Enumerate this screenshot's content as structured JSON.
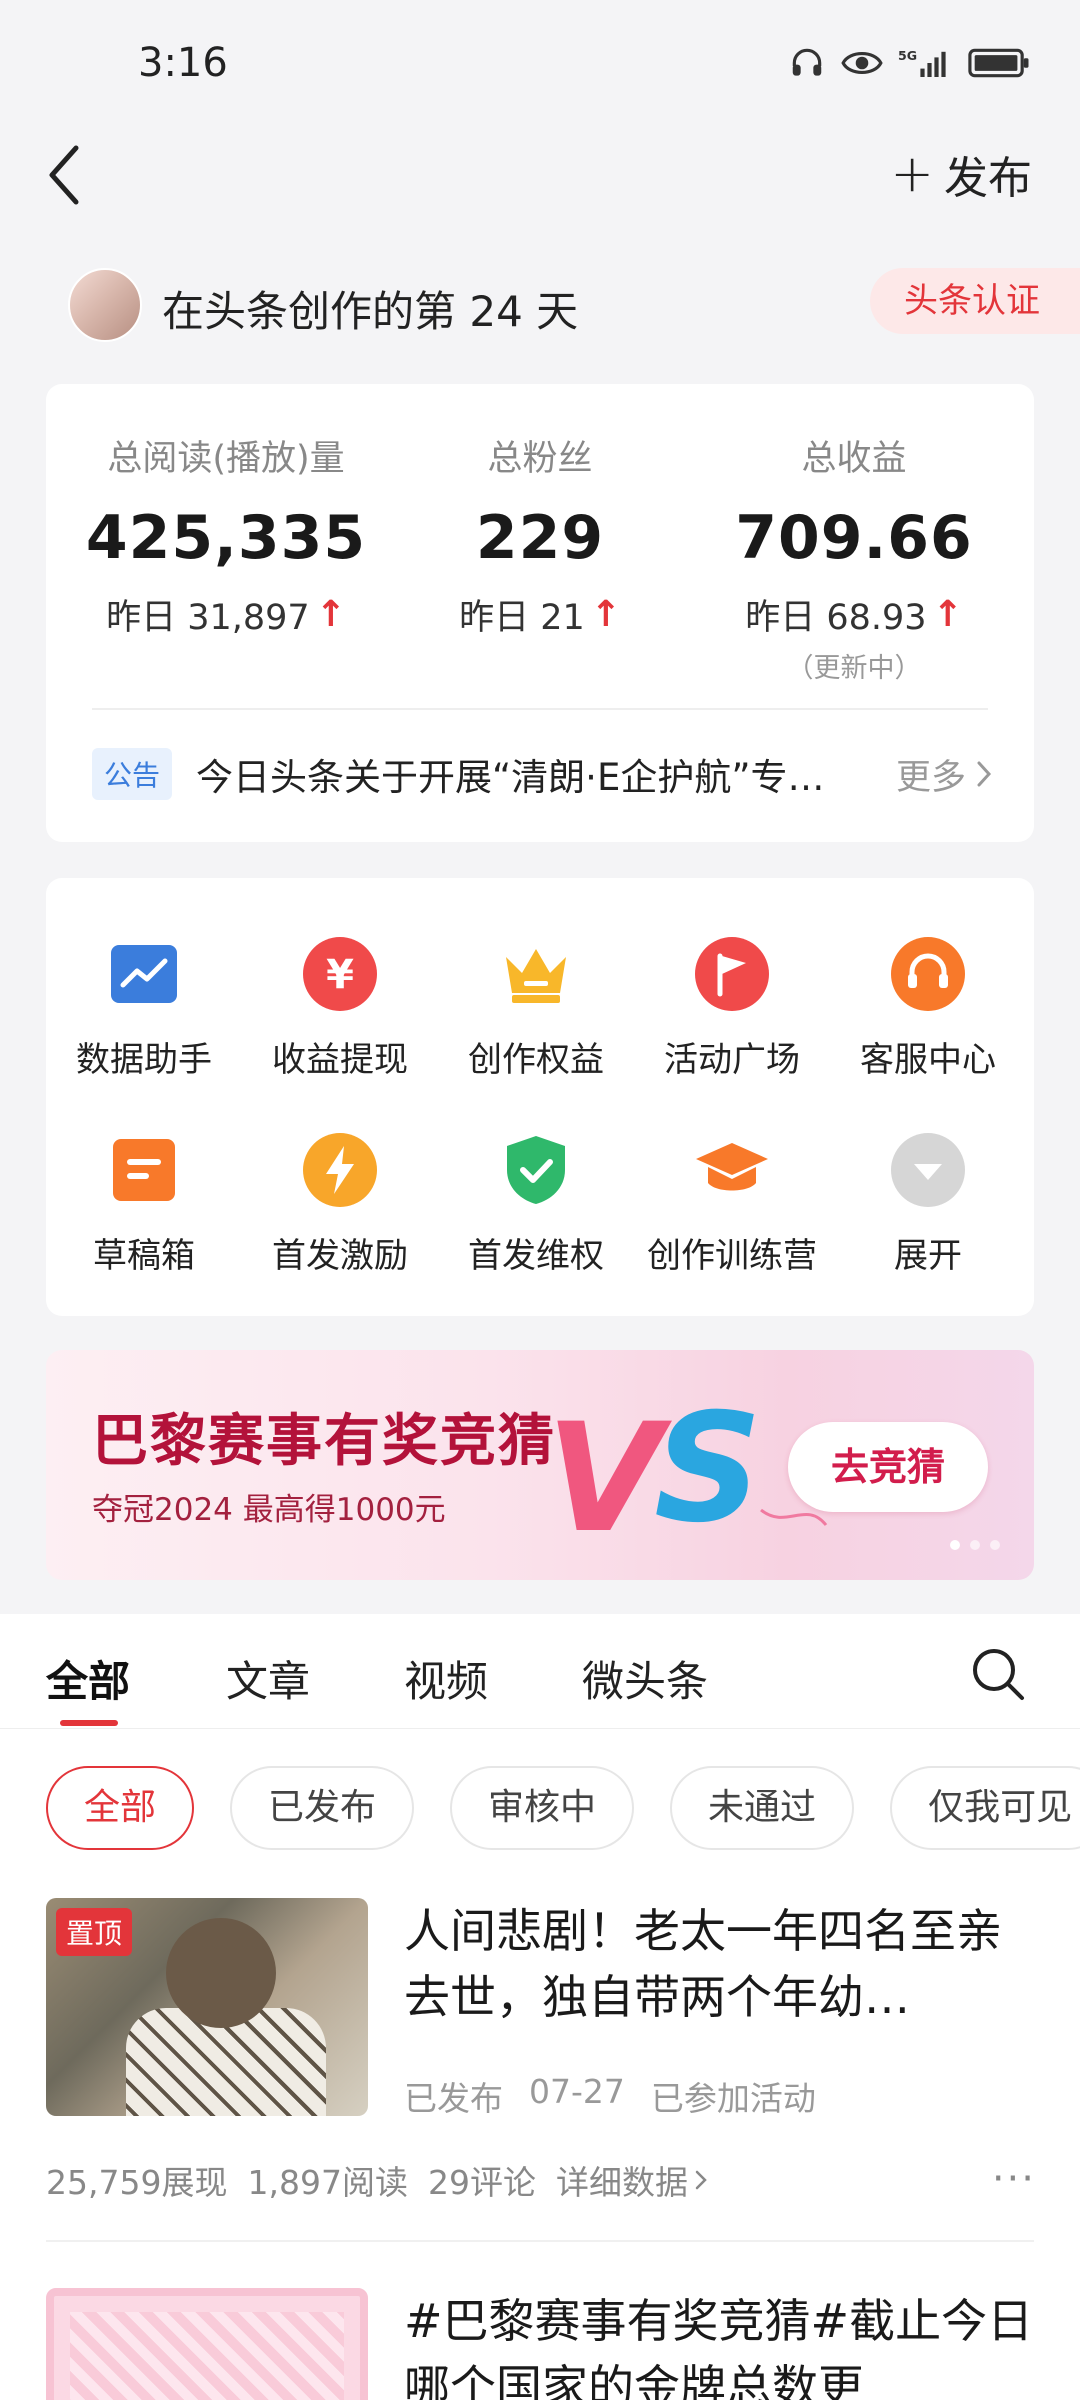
{
  "status": {
    "time": "3:16",
    "network": "5G"
  },
  "header": {
    "publish_label": "发布"
  },
  "creator": {
    "days_text": "在头条创作的第 24 天",
    "cert_label": "头条认证"
  },
  "stats": [
    {
      "label": "总阅读(播放)量",
      "value": "425,335",
      "yesterday": "昨日 31,897",
      "note": ""
    },
    {
      "label": "总粉丝",
      "value": "229",
      "yesterday": "昨日 21",
      "note": ""
    },
    {
      "label": "总收益",
      "value": "709.66",
      "yesterday": "昨日 68.93",
      "note": "（更新中）"
    }
  ],
  "notice": {
    "tag": "公告",
    "text": "今日头条关于开展“清朗·E企护航”专项行动的公告",
    "more": "更多"
  },
  "tools": [
    {
      "label": "数据助手",
      "icon": "chart-icon",
      "color": "#3b7ddc"
    },
    {
      "label": "收益提现",
      "icon": "yuan-icon",
      "color": "#f04a4a"
    },
    {
      "label": "创作权益",
      "icon": "crown-icon",
      "color": "#f8b72a"
    },
    {
      "label": "活动广场",
      "icon": "flag-icon",
      "color": "#f04a4a"
    },
    {
      "label": "客服中心",
      "icon": "headset-icon",
      "color": "#f8792a"
    },
    {
      "label": "草稿箱",
      "icon": "draft-icon",
      "color": "#f8792a"
    },
    {
      "label": "首发激励",
      "icon": "lightning-icon",
      "color": "#f8a62a"
    },
    {
      "label": "首发维权",
      "icon": "shield-check-icon",
      "color": "#2fb86b"
    },
    {
      "label": "创作训练营",
      "icon": "graduation-cap-icon",
      "color": "#f8792a"
    },
    {
      "label": "展开",
      "icon": "expand-icon",
      "color": "#d6d6d6"
    }
  ],
  "banner": {
    "title": "巴黎赛事有奖竞猜",
    "subtitle": "夺冠2024 最高得1000元",
    "vs_text": "VS",
    "button": "去竞猜"
  },
  "tabs": [
    "全部",
    "文章",
    "视频",
    "微头条"
  ],
  "filters": [
    "全部",
    "已发布",
    "审核中",
    "未通过",
    "仅我可见"
  ],
  "articles": [
    {
      "pin": "置顶",
      "title": "人间悲剧！老太一年四名至亲去世，独自带两个年幼…",
      "status": "已发布",
      "date": "07-27",
      "activity": "已参加活动",
      "impressions": "25,759展现",
      "reads": "1,897阅读",
      "comments": "29评论",
      "detail": "详细数据"
    },
    {
      "title": "#巴黎赛事有奖竞猜#截止今日哪个国家的金牌总数更"
    }
  ]
}
